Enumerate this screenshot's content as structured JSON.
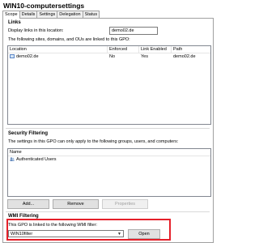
{
  "window": {
    "title": "WIN10-computersettings"
  },
  "tabs": [
    "Scope",
    "Details",
    "Settings",
    "Delegation",
    "Status"
  ],
  "links": {
    "heading": "Links",
    "display_label": "Display links in this location:",
    "location_value": "demo02.de",
    "description": "The following sites, domains, and OUs are linked to this GPO:",
    "columns": [
      "Location",
      "Enforced",
      "Link Enabled",
      "Path"
    ],
    "rows": [
      {
        "location": "demo02.de",
        "enforced": "No",
        "link_enabled": "Yes",
        "path": "demo02.de"
      }
    ]
  },
  "security_filtering": {
    "heading": "Security Filtering",
    "description": "The settings in this GPO can only apply to the following groups, users, and computers:",
    "column": "Name",
    "items": [
      "Authenticated Users"
    ],
    "buttons": {
      "add": "Add...",
      "remove": "Remove",
      "properties": "Properties"
    }
  },
  "wmi_filtering": {
    "heading": "WMI Filtering",
    "description": "This GPO is linked to the following WMI filter:",
    "selected": "WIN10filter",
    "open_button": "Open"
  },
  "colors": {
    "highlight_border": "#e5202a"
  }
}
